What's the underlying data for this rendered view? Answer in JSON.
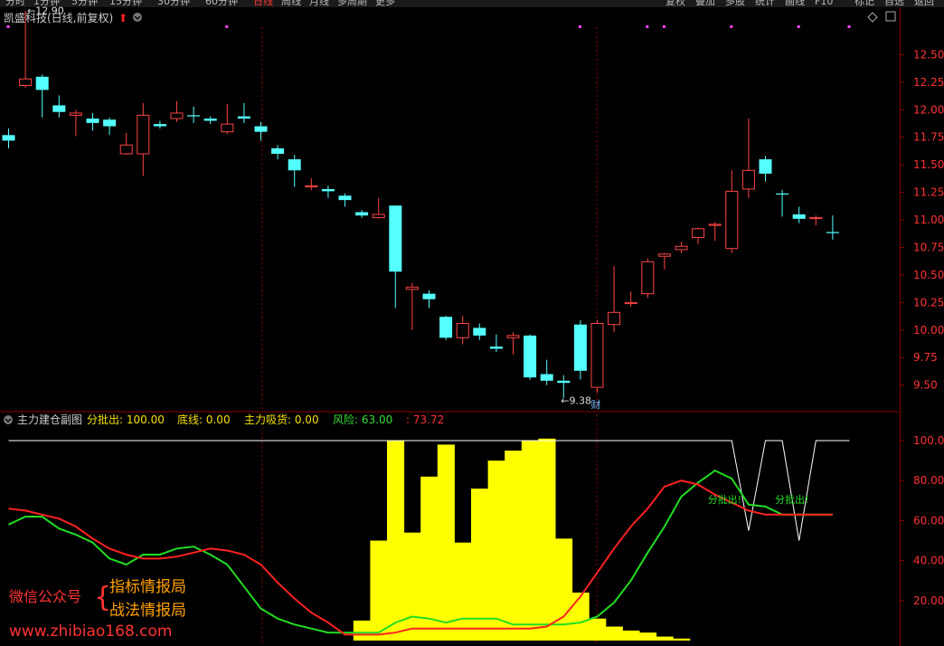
{
  "toolbar": {
    "left_items": [
      "分时",
      "1分钟",
      "5分钟",
      "15分钟",
      "30分钟",
      "60分钟",
      "日线",
      "周线",
      "月线",
      "多周期",
      "更多"
    ],
    "active_item": "日线",
    "right_items": [
      "复权",
      "叠加",
      "多股",
      "统计",
      "画线",
      "F10",
      "标记",
      "自选",
      "返回"
    ]
  },
  "title": "凯盛科技(日线,前复权)",
  "indicator": {
    "name": "主力建仓副图",
    "fields": [
      {
        "label": "分批出:",
        "value": "100.00",
        "color": "#f5e100"
      },
      {
        "label": "底线:",
        "value": "0.00",
        "color": "#f5e100"
      },
      {
        "label": "主力吸货:",
        "value": "0.00",
        "color": "#f5e100"
      },
      {
        "label": "风险:",
        "value": "63.00",
        "color": "#33dd33"
      },
      {
        "label": ":",
        "value": "73.72",
        "color": "#ff3333"
      }
    ],
    "signals": [
      "分批出!",
      "分批出!"
    ]
  },
  "watermark": {
    "brand": "微信公众号",
    "line1": "指标情报局",
    "line2": "战法情报局",
    "url": "www.zhibiao168.com"
  },
  "colors": {
    "up": "#ff4444",
    "down": "#54ffff",
    "yellow": "#ffff00",
    "green": "#22dd22",
    "red": "#ff2222",
    "grid": "#8b0000"
  },
  "chart_data": [
    {
      "type": "candlestick",
      "ylim": [
        9.3,
        12.75
      ],
      "yticks": [
        9.5,
        9.75,
        10.0,
        10.25,
        10.5,
        10.75,
        11.0,
        11.25,
        11.5,
        11.75,
        12.0,
        12.25,
        12.5
      ],
      "annotations": {
        "high": "12.90",
        "low": "9.38",
        "event_marker": "财"
      },
      "candles": [
        [
          11.77,
          11.72,
          11.83,
          11.65
        ],
        [
          12.22,
          12.28,
          12.9,
          12.2
        ],
        [
          12.3,
          12.18,
          12.32,
          11.93
        ],
        [
          12.04,
          11.98,
          12.13,
          11.93
        ],
        [
          11.95,
          11.97,
          12.0,
          11.76
        ],
        [
          11.92,
          11.88,
          11.97,
          11.81
        ],
        [
          11.91,
          11.85,
          11.93,
          11.77
        ],
        [
          11.6,
          11.68,
          11.79,
          11.59
        ],
        [
          11.6,
          11.95,
          12.06,
          11.4
        ],
        [
          11.87,
          11.85,
          11.9,
          11.83
        ],
        [
          11.92,
          11.97,
          12.08,
          11.89
        ],
        [
          11.95,
          11.94,
          12.03,
          11.88
        ],
        [
          11.92,
          11.9,
          11.94,
          11.87
        ],
        [
          11.8,
          11.87,
          12.05,
          11.78
        ],
        [
          11.94,
          11.92,
          12.06,
          11.88
        ],
        [
          11.85,
          11.8,
          11.89,
          11.72
        ],
        [
          11.65,
          11.6,
          11.68,
          11.55
        ],
        [
          11.55,
          11.45,
          11.59,
          11.3
        ],
        [
          11.3,
          11.31,
          11.38,
          11.27
        ],
        [
          11.28,
          11.26,
          11.31,
          11.2
        ],
        [
          11.22,
          11.18,
          11.24,
          11.12
        ],
        [
          11.07,
          11.04,
          11.09,
          11.02
        ],
        [
          11.02,
          11.05,
          11.2,
          11.01
        ],
        [
          11.13,
          10.53,
          11.13,
          10.2
        ],
        [
          10.37,
          10.39,
          10.43,
          10.0
        ],
        [
          10.33,
          10.28,
          10.36,
          10.2
        ],
        [
          10.12,
          9.93,
          10.13,
          9.91
        ],
        [
          9.93,
          10.06,
          10.13,
          9.87
        ],
        [
          10.02,
          9.95,
          10.06,
          9.91
        ],
        [
          9.85,
          9.83,
          9.96,
          9.8
        ],
        [
          9.93,
          9.95,
          9.98,
          9.78
        ],
        [
          9.95,
          9.57,
          9.96,
          9.55
        ],
        [
          9.6,
          9.54,
          9.73,
          9.5
        ],
        [
          9.54,
          9.52,
          9.59,
          9.38
        ],
        [
          10.05,
          9.63,
          10.09,
          9.55
        ],
        [
          9.48,
          10.06,
          10.09,
          9.43
        ],
        [
          10.05,
          10.16,
          10.58,
          9.98
        ],
        [
          10.24,
          10.25,
          10.35,
          10.21
        ],
        [
          10.33,
          10.62,
          10.65,
          10.29
        ],
        [
          10.67,
          10.69,
          10.7,
          10.55
        ],
        [
          10.73,
          10.76,
          10.8,
          10.7
        ],
        [
          10.84,
          10.92,
          10.93,
          10.78
        ],
        [
          10.95,
          10.96,
          10.98,
          10.81
        ],
        [
          10.74,
          11.26,
          11.45,
          10.7
        ],
        [
          11.28,
          11.45,
          11.92,
          11.2
        ],
        [
          11.55,
          11.42,
          11.58,
          11.35
        ],
        [
          11.24,
          11.23,
          11.27,
          11.03
        ],
        [
          11.05,
          11.01,
          11.12,
          10.97
        ],
        [
          11.02,
          11.02,
          11.04,
          10.95
        ],
        [
          10.89,
          10.88,
          11.04,
          10.82
        ]
      ]
    },
    {
      "type": "mixed",
      "ylim": [
        0,
        102
      ],
      "yticks": [
        20,
        40,
        60,
        80,
        100
      ],
      "series": [
        {
          "name": "分批出",
          "style": "line",
          "color": "#ffffff",
          "values": [
            100,
            100,
            100,
            100,
            100,
            100,
            100,
            100,
            100,
            100,
            100,
            100,
            100,
            100,
            100,
            100,
            100,
            100,
            100,
            100,
            100,
            100,
            100,
            100,
            100,
            100,
            100,
            100,
            100,
            100,
            100,
            100,
            100,
            100,
            100,
            100,
            100,
            100,
            100,
            100,
            100,
            100,
            100,
            100,
            55,
            100,
            100,
            50,
            100,
            100,
            100
          ]
        },
        {
          "name": "主力吸货",
          "style": "bar",
          "color": "#ffff00",
          "values": [
            0,
            0,
            0,
            0,
            0,
            0,
            0,
            0,
            0,
            0,
            0,
            0,
            0,
            0,
            0,
            0,
            0,
            0,
            0,
            0,
            0,
            10,
            50,
            100,
            54,
            82,
            98,
            49,
            76,
            90,
            95,
            100,
            101,
            51,
            24,
            11,
            7,
            5,
            4,
            2,
            1,
            0,
            0,
            0,
            0,
            0,
            0,
            0,
            0,
            0
          ]
        },
        {
          "name": "风险",
          "style": "line",
          "color": "#22dd22",
          "values": [
            58,
            62,
            62,
            56,
            53,
            49,
            41,
            38,
            43,
            43,
            46,
            47,
            43,
            38,
            27,
            16,
            11,
            8,
            6,
            4,
            4,
            4,
            4,
            9,
            12,
            11,
            9,
            11,
            11,
            11,
            8,
            8,
            8,
            8,
            9,
            12,
            19,
            30,
            44,
            57,
            72,
            79,
            85,
            81,
            68,
            67,
            63,
            63,
            63,
            63
          ]
        },
        {
          "name": "风险",
          "style": "line",
          "color": "#ff2222",
          "values": [
            66,
            65,
            63,
            61,
            57,
            51,
            46,
            43,
            41,
            41,
            42,
            44,
            46,
            45,
            43,
            38,
            29,
            21,
            14,
            9,
            3,
            3,
            3,
            4,
            6,
            6,
            6,
            6,
            6,
            6,
            6,
            6,
            7,
            12,
            22,
            34,
            46,
            57,
            66,
            77,
            80,
            78,
            73,
            69,
            65,
            63,
            63,
            63,
            63,
            63
          ]
        }
      ],
      "signal_labels": [
        "分批出!",
        "分批出!"
      ]
    }
  ]
}
